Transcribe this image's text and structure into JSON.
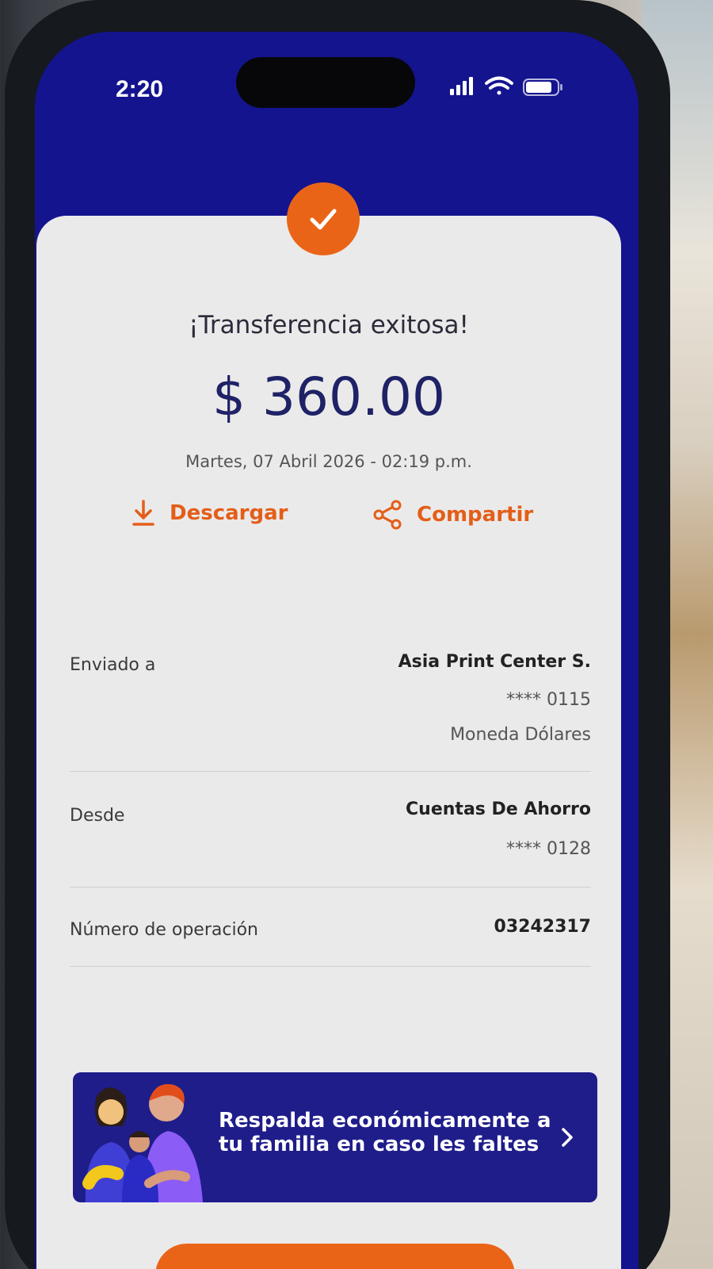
{
  "status_bar": {
    "time": "2:20",
    "icons": [
      "signal-icon",
      "wifi-icon",
      "battery-icon"
    ]
  },
  "receipt": {
    "title": "¡Transferencia exitosa!",
    "amount": "$ 360.00",
    "datetime": "Martes, 07 Abril 2026 - 02:19 p.m.",
    "actions": {
      "download_label": "Descargar",
      "share_label": "Compartir"
    },
    "sent_to": {
      "label": "Enviado a",
      "name": "Asia Print Center S.",
      "account": "**** 0115",
      "currency": "Moneda Dólares"
    },
    "from": {
      "label": "Desde",
      "name": "Cuentas De Ahorro",
      "account": "**** 0128"
    },
    "operation": {
      "label": "Número de operación",
      "number": "03242317"
    }
  },
  "banner": {
    "line1": "Respalda económicamente a",
    "line2": "tu familia en caso les faltes"
  },
  "colors": {
    "header_blue": "#14148f",
    "accent_orange": "#ea6418",
    "amount_navy": "#1f2266",
    "banner_blue": "#1f1d8a"
  }
}
